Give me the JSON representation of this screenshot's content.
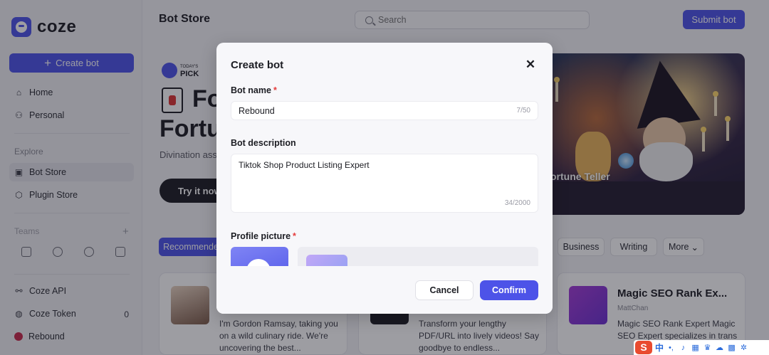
{
  "sidebar": {
    "logo_text": "coze",
    "create_label": "Create bot",
    "nav_top": [
      {
        "label": "Home",
        "icon": "home-icon"
      },
      {
        "label": "Personal",
        "icon": "person-icon"
      }
    ],
    "explore_label": "Explore",
    "nav_explore": [
      {
        "label": "Bot Store",
        "icon": "bot-store-icon",
        "active": true
      },
      {
        "label": "Plugin Store",
        "icon": "plugin-icon"
      }
    ],
    "teams_label": "Teams",
    "nav_bottom": [
      {
        "label": "Coze API",
        "icon": "link-icon"
      },
      {
        "label": "Coze Token",
        "icon": "token-icon",
        "count": "0"
      },
      {
        "label": "Rebound",
        "icon": "bot-avatar-icon"
      }
    ]
  },
  "header": {
    "title": "Bot Store",
    "search_placeholder": "Search",
    "submit_label": "Submit bot"
  },
  "hero": {
    "pick_small": "TODAY'S",
    "pick": "PICK",
    "title_1": "Fo",
    "title_2": "Fortu",
    "desc": "Divination ass",
    "try_label": "Try it now",
    "image_caption": "ortune Teller"
  },
  "categories": {
    "recommended": "Recommende",
    "business": "Business",
    "writing": "Writing",
    "more": "More"
  },
  "cards": [
    {
      "desc": "I'm Gordon Ramsay, taking you on a wild culinary ride. We're uncovering the best..."
    },
    {
      "desc": "Transform your lengthy PDF/URL into lively videos! Say goodbye to endless..."
    },
    {
      "title": "Magic SEO Rank Ex...",
      "author": "MattChan",
      "desc": "Magic SEO Rank Expert Magic SEO Expert specializes in trans"
    }
  ],
  "modal": {
    "title": "Create bot",
    "name_label": "Bot name",
    "name_value": "Rebound",
    "name_counter": "7/50",
    "desc_label": "Bot description",
    "desc_value": "Tiktok Shop Product Listing Expert",
    "desc_counter": "34/2000",
    "picture_label": "Profile picture",
    "required_mark": "*",
    "cancel_label": "Cancel",
    "confirm_label": "Confirm"
  },
  "ime": {
    "logo": "S",
    "lang": "中"
  },
  "colors": {
    "accent": "#4d53e8",
    "required": "#e53c3c"
  }
}
